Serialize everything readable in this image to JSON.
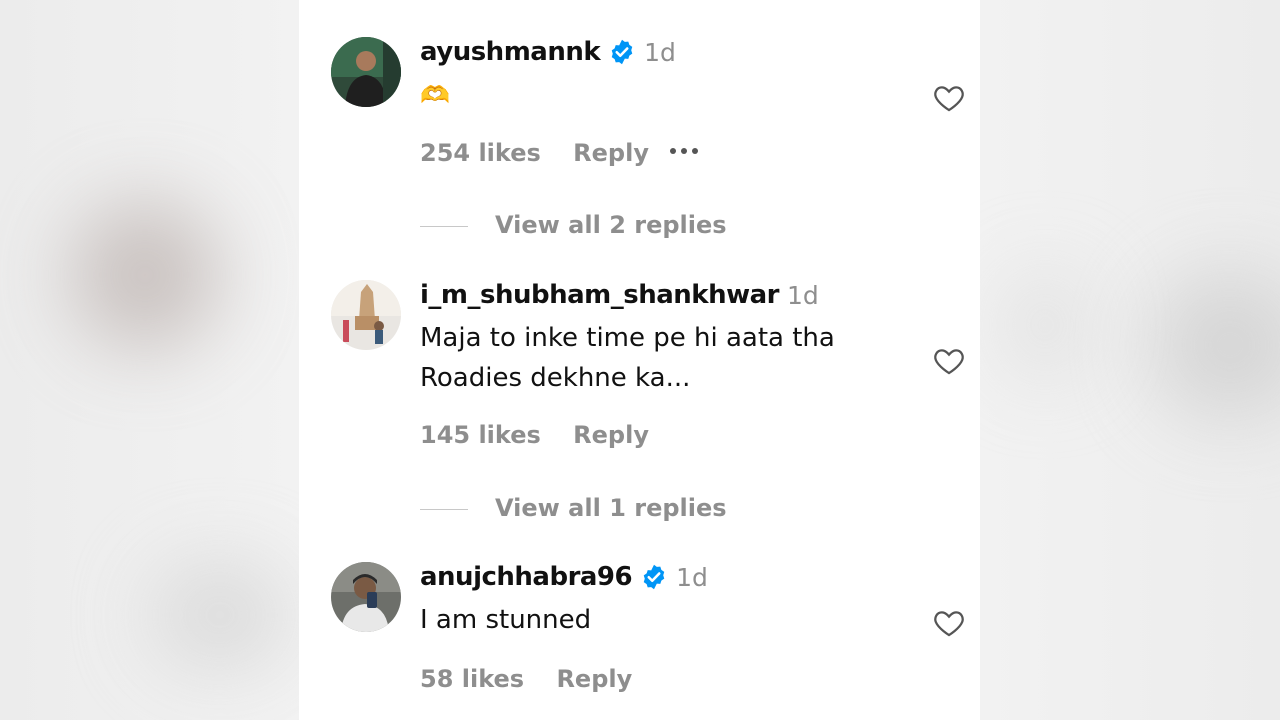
{
  "colors": {
    "text": "#111111",
    "muted": "#8e8e8e",
    "verified": "#0095f6",
    "background": "#ffffff"
  },
  "comments": [
    {
      "username": "ayushmannk",
      "verified": true,
      "time": "1d",
      "text_lines": [
        "🫶"
      ],
      "likes": "254 likes",
      "reply_label": "Reply",
      "has_more_menu": true,
      "view_replies": "View all 2 replies"
    },
    {
      "username": "i_m_shubham_shankhwar",
      "verified": false,
      "time": "1d",
      "text_lines": [
        "Maja to inke time pe hi aata tha",
        "Roadies dekhne ka..."
      ],
      "likes": "145 likes",
      "reply_label": "Reply",
      "has_more_menu": false,
      "view_replies": "View all 1 replies"
    },
    {
      "username": "anujchhabra96",
      "verified": true,
      "time": "1d",
      "text_lines": [
        "I am stunned"
      ],
      "likes": "58 likes",
      "reply_label": "Reply",
      "has_more_menu": false,
      "view_replies": ""
    }
  ],
  "icons": {
    "like": "heart-outline-icon",
    "verified": "verified-badge-icon",
    "more": "more-horizontal-icon"
  }
}
